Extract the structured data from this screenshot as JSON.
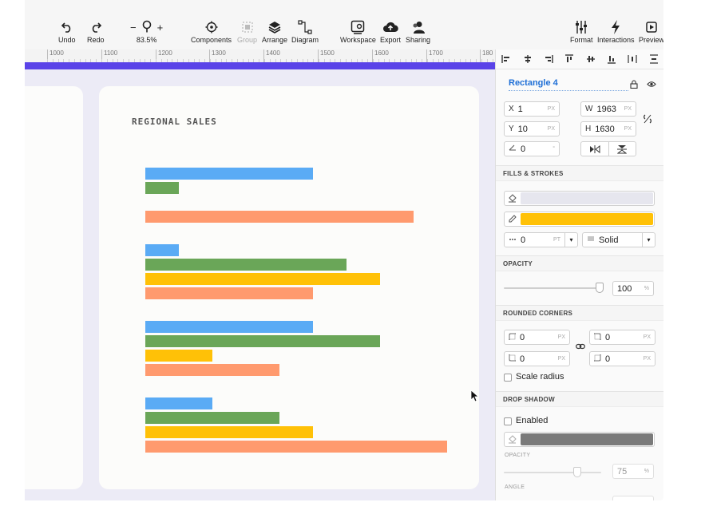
{
  "toolbar": {
    "undo": "Undo",
    "redo": "Redo",
    "zoom_minus": "−",
    "zoom_plus": "+",
    "zoom": "83.5%",
    "components": "Components",
    "group": "Group",
    "arrange": "Arrange",
    "diagram": "Diagram",
    "workspace": "Workspace",
    "export": "Export",
    "sharing": "Sharing",
    "format": "Format",
    "interactions": "Interactions",
    "preview": "Preview"
  },
  "ruler": {
    "labels": [
      "1000",
      "1100",
      "1200",
      "1300",
      "1400",
      "1500",
      "1600",
      "1700",
      "180"
    ]
  },
  "canvas": {
    "chart_title": "REGIONAL SALES",
    "colors": {
      "selection": "#5a43e8",
      "background": "#ecebf6",
      "artboard": "#fcfcfa",
      "circle": "#4f6ef5"
    }
  },
  "chart_data": {
    "type": "bar",
    "orientation": "horizontal",
    "title": "REGIONAL SALES",
    "groups": [
      {
        "bars": [
          {
            "color": "#5aabf5",
            "value": 5
          },
          {
            "color": "#6aa658",
            "value": 1
          },
          {
            "color": "#ff9a6e",
            "value": 8
          }
        ]
      },
      {
        "bars": [
          {
            "color": "#5aabf5",
            "value": 1
          },
          {
            "color": "#6aa658",
            "value": 6
          },
          {
            "color": "#ffc107",
            "value": 7
          },
          {
            "color": "#ff9a6e",
            "value": 5
          }
        ]
      },
      {
        "bars": [
          {
            "color": "#5aabf5",
            "value": 5
          },
          {
            "color": "#6aa658",
            "value": 7
          },
          {
            "color": "#ffc107",
            "value": 2
          },
          {
            "color": "#ff9a6e",
            "value": 4
          }
        ]
      },
      {
        "bars": [
          {
            "color": "#5aabf5",
            "value": 2
          },
          {
            "color": "#6aa658",
            "value": 4
          },
          {
            "color": "#ffc107",
            "value": 5
          },
          {
            "color": "#ff9a6e",
            "value": 9
          }
        ]
      }
    ],
    "xlim": [
      0,
      9
    ]
  },
  "panel": {
    "layer_name": "Rectangle 4",
    "x_label": "X",
    "x_value": "1",
    "x_unit": "PX",
    "w_label": "W",
    "w_value": "1963",
    "w_unit": "PX",
    "y_label": "Y",
    "y_value": "10",
    "y_unit": "PX",
    "h_label": "H",
    "h_value": "1630",
    "h_unit": "PX",
    "angle_value": "0",
    "angle_unit": "°",
    "fills_title": "FILLS & STROKES",
    "fill_color": "#e6e6ee",
    "stroke_color": "#ffc107",
    "stroke_width": "0",
    "stroke_unit": "PT",
    "stroke_style": "Solid",
    "opacity_title": "OPACITY",
    "opacity_value": "100",
    "opacity_unit": "%",
    "opacity_level": 1.0,
    "corners_title": "ROUNDED CORNERS",
    "corner_tl": "0",
    "corner_tr": "0",
    "corner_bl": "0",
    "corner_br": "0",
    "corner_unit": "PX",
    "scale_radius": "Scale radius",
    "shadow_title": "DROP SHADOW",
    "shadow_enabled": "Enabled",
    "shadow_color": "#7a7a7a",
    "shadow_opacity_label": "OPACITY",
    "shadow_opacity_value": "75",
    "shadow_opacity_unit": "%",
    "shadow_opacity_level": 0.75,
    "shadow_angle_label": "ANGLE"
  }
}
